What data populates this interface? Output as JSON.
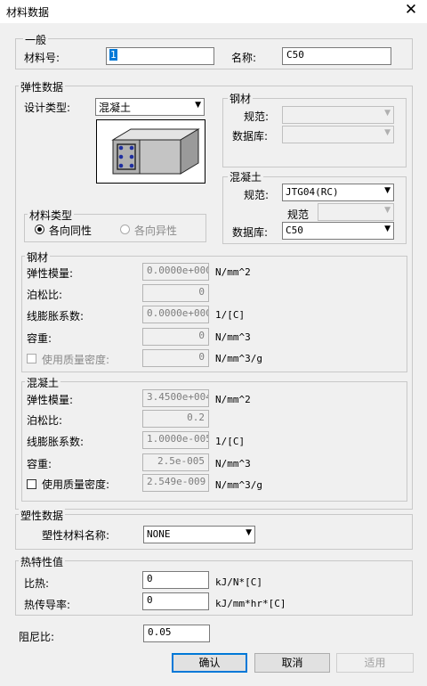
{
  "window": {
    "title": "材料数据"
  },
  "general": {
    "legend": "一般",
    "material_no_label": "材料号:",
    "material_no_value": "1",
    "name_label": "名称:",
    "name_value": "C50"
  },
  "elastic": {
    "legend": "弹性数据",
    "design_type_label": "设计类型:",
    "design_type_value": "混凝土",
    "steel_box": {
      "legend": "钢材",
      "spec_label": "规范:",
      "db_label": "数据库:"
    },
    "concrete_box": {
      "legend": "混凝土",
      "spec_label": "规范:",
      "spec_value": "JTG04(RC)",
      "sub_spec_label": "规范",
      "db_label": "数据库:",
      "db_value": "C50"
    },
    "material_type": {
      "legend": "材料类型",
      "isotropic": "各向同性",
      "anisotropic": "各向异性",
      "selected": "isotropic"
    },
    "steel": {
      "legend": "钢材",
      "modulus_label": "弹性模量:",
      "modulus_value": "0.0000e+000",
      "modulus_unit": "N/mm^2",
      "poisson_label": "泊松比:",
      "poisson_value": "0",
      "expansion_label": "线膨胀系数:",
      "expansion_value": "0.0000e+000",
      "expansion_unit": "1/[C]",
      "weight_label": "容重:",
      "weight_value": "0",
      "weight_unit": "N/mm^3",
      "mass_density_label": "使用质量密度:",
      "mass_density_value": "0",
      "mass_density_unit": "N/mm^3/g",
      "mass_density_checked": false
    },
    "concrete": {
      "legend": "混凝土",
      "modulus_label": "弹性模量:",
      "modulus_value": "3.4500e+004",
      "modulus_unit": "N/mm^2",
      "poisson_label": "泊松比:",
      "poisson_value": "0.2",
      "expansion_label": "线膨胀系数:",
      "expansion_value": "1.0000e-005",
      "expansion_unit": "1/[C]",
      "weight_label": "容重:",
      "weight_value": "2.5e-005",
      "weight_unit": "N/mm^3",
      "mass_density_label": "使用质量密度:",
      "mass_density_value": "2.549e-009",
      "mass_density_unit": "N/mm^3/g",
      "mass_density_checked": false
    }
  },
  "plastic": {
    "legend": "塑性数据",
    "name_label": "塑性材料名称:",
    "name_value": "NONE"
  },
  "thermal": {
    "legend": "热特性值",
    "specific_heat_label": "比热:",
    "specific_heat_value": "0",
    "specific_heat_unit": "kJ/N*[C]",
    "conductivity_label": "热传导率:",
    "conductivity_value": "0",
    "conductivity_unit": "kJ/mm*hr*[C]"
  },
  "damping": {
    "label": "阻尼比:",
    "value": "0.05"
  },
  "buttons": {
    "ok": "确认",
    "cancel": "取消",
    "apply": "适用"
  }
}
